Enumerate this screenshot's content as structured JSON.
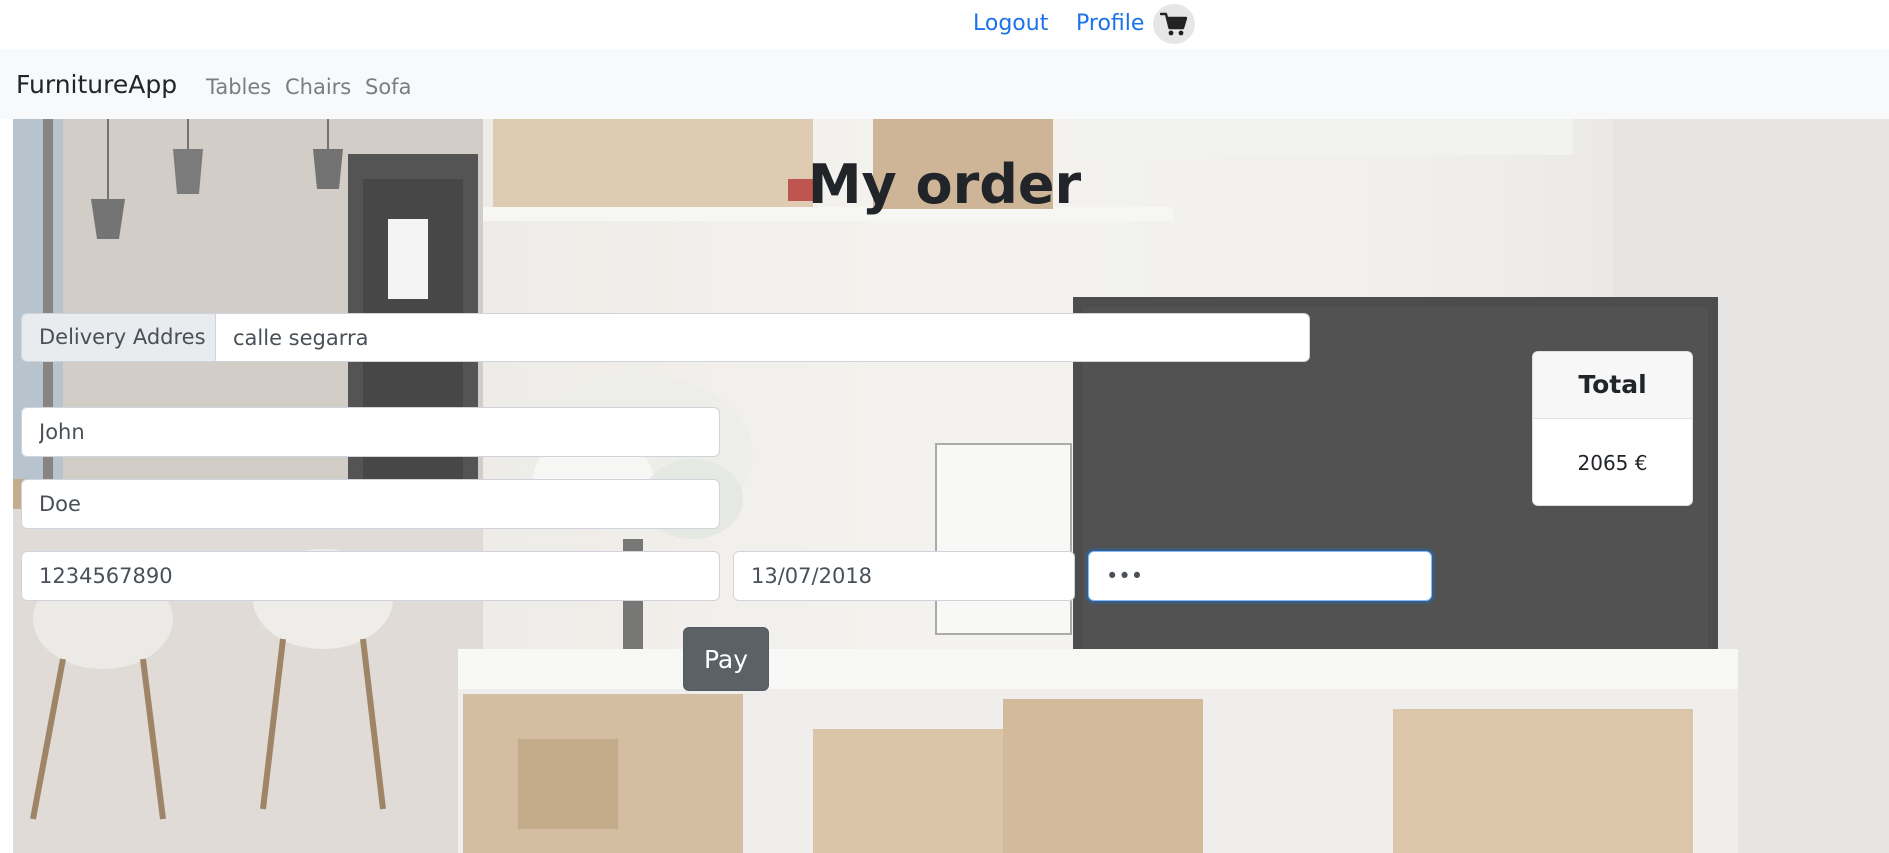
{
  "topbar": {
    "logout_label": "Logout",
    "profile_label": "Profile",
    "cart_icon": "cart-icon"
  },
  "navbar": {
    "brand": "FurnitureApp",
    "items": [
      {
        "label": "Tables"
      },
      {
        "label": "Chairs"
      },
      {
        "label": "Sofa"
      }
    ]
  },
  "page": {
    "title": "My order"
  },
  "form": {
    "delivery_label": "Delivery Addres",
    "delivery_value": "calle segarra",
    "first_name_value": "John",
    "last_name_value": "Doe",
    "card_number_value": "1234567890",
    "expiry_value": "13/07/2018",
    "cvv_value": "123",
    "pay_label": "Pay"
  },
  "total": {
    "header": "Total",
    "amount": "2065 €"
  },
  "colors": {
    "link": "#1a73e8",
    "navbar_bg": "#f8f9fa",
    "pay_button": "#5a6268",
    "focus_ring": "#80bdff"
  }
}
